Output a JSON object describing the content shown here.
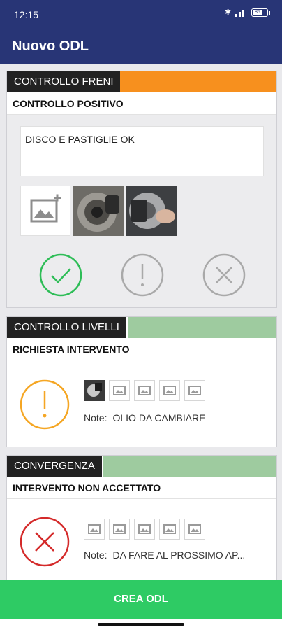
{
  "status_bar": {
    "time": "12:15",
    "battery": "86"
  },
  "app_bar": {
    "title": "Nuovo ODL"
  },
  "cards": [
    {
      "category": "CONTROLLO FRENI",
      "accent_color": "#f7901e",
      "status": "CONTROLLO POSITIVO",
      "note": "DISCO E PASTIGLIE OK",
      "actions": [
        "check-icon",
        "warning-icon",
        "close-icon"
      ],
      "selected_action": "check-icon"
    },
    {
      "category": "CONTROLLO LIVELLI",
      "accent_color": "#9ecb9f",
      "status": "RICHIESTA INTERVENTO",
      "note_label": "Note:",
      "note": "OLIO DA CAMBIARE",
      "status_color": "#f5a623"
    },
    {
      "category": "CONVERGENZA",
      "accent_color": "#9ecb9f",
      "status": "INTERVENTO NON ACCETTATO",
      "note_label": "Note:",
      "note": "DA FARE AL PROSSIMO AP...",
      "status_color": "#d42a2a"
    }
  ],
  "primary_action": {
    "label": "CREA ODL",
    "color": "#2ecb64"
  }
}
